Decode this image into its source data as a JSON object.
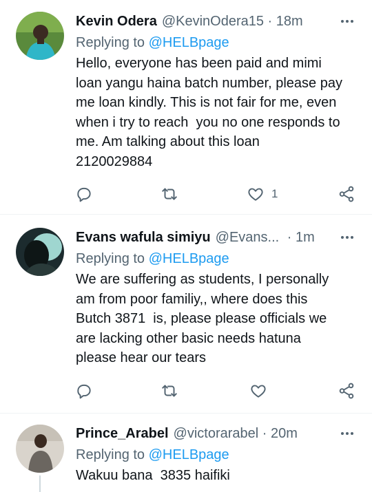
{
  "tweets": [
    {
      "name": "Kevin Odera",
      "handle": "@KevinOdera15",
      "separator": " · ",
      "time": "18m",
      "replying_prefix": "Replying to ",
      "replying_to": "@HELBpage",
      "text_lines": [
        "Hello, everyone has been paid and mimi",
        "loan yangu haina batch number, please pay",
        "me loan kindly. This is not fair for me, even",
        "when i try to reach  you no one responds to",
        "me. Am talking about this loan",
        "2120029884"
      ],
      "likes": "1"
    },
    {
      "name": "Evans wafula simiyu",
      "handle": "@Evans...",
      "separator": " · ",
      "time": "1m",
      "replying_prefix": "Replying to ",
      "replying_to": "@HELBpage",
      "text_lines": [
        "We are suffering as students, I personally",
        "am from poor familiy,, where does this",
        "Butch 3871  is, please please officials we",
        "are lacking other basic needs hatuna",
        "please hear our tears"
      ],
      "likes": ""
    },
    {
      "name": "Prince_Arabel",
      "handle": "@victorarabel",
      "separator": " · ",
      "time": "20m",
      "replying_prefix": "Replying to ",
      "replying_to": "@HELBpage",
      "text_lines": [
        "Wakuu bana  3835 haifiki"
      ]
    }
  ],
  "icons": {
    "more": "more-horizontal-icon",
    "reply": "reply-bubble-icon",
    "retweet": "retweet-icon",
    "like": "heart-icon",
    "share": "share-icon"
  },
  "colors": {
    "text": "#0f1419",
    "secondary": "#536471",
    "link": "#1d9bf0",
    "divider": "#eff3f4"
  }
}
